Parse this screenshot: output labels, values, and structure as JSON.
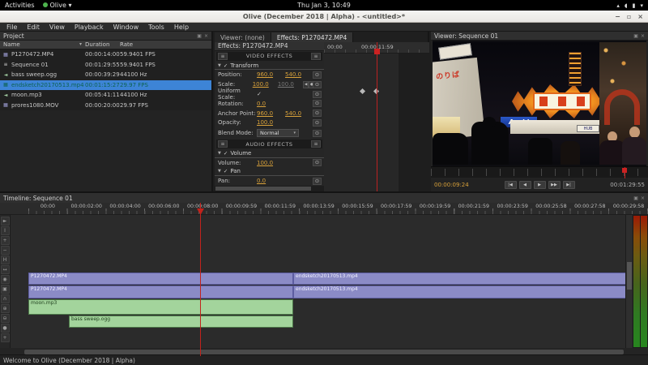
{
  "gnome_bar": {
    "activities": "Activities",
    "app_name": "Olive",
    "app_chevron": "▾",
    "clock": "Thu Jan 3, 10:49",
    "tray_icons": [
      {
        "name": "network-icon",
        "glyph": "▴"
      },
      {
        "name": "volume-icon",
        "glyph": "◖"
      },
      {
        "name": "battery-icon",
        "glyph": "▮"
      },
      {
        "name": "chevron-down-icon",
        "glyph": "▾"
      }
    ]
  },
  "window": {
    "title": "Olive (December 2018 | Alpha) - <untitled>*",
    "minimize_glyph": "−",
    "maximize_glyph": "▫",
    "close_glyph": "×"
  },
  "menu_bar": {
    "items": [
      "File",
      "Edit",
      "View",
      "Playback",
      "Window",
      "Tools",
      "Help"
    ]
  },
  "icons": {
    "panel_popout": "▣",
    "panel_close": "×",
    "menu": "≡",
    "collapse": "▼",
    "check": "✓",
    "keyframe_toggle": "⊙",
    "sort": "▾",
    "dropdown": "▾"
  },
  "project_panel": {
    "title": "Project",
    "columns": {
      "name": "Name",
      "duration": "Duration",
      "rate": "Rate"
    },
    "items": [
      {
        "name": "P1270472.MP4",
        "duration": "00:00:14:00",
        "rate": "59.9401 FPS",
        "type": "video",
        "selected": false
      },
      {
        "name": "Sequence 01",
        "duration": "00:01:29:55",
        "rate": "59.9401 FPS",
        "type": "sequence",
        "selected": false
      },
      {
        "name": "bass sweep.ogg",
        "duration": "00:00:39:29",
        "rate": "44100 Hz",
        "type": "audio",
        "selected": false
      },
      {
        "name": "endsketch20170513.mp4",
        "duration": "00:01:15:27",
        "rate": "29.97 FPS",
        "type": "video",
        "selected": true
      },
      {
        "name": "moon.mp3",
        "duration": "00:05:41:11",
        "rate": "44100 Hz",
        "type": "audio",
        "selected": false
      },
      {
        "name": "prores1080.MOV",
        "duration": "00:00:20:00",
        "rate": "29.97 FPS",
        "type": "video",
        "selected": false
      }
    ]
  },
  "effects_panel": {
    "tabs": [
      {
        "label": "Viewer: (none)",
        "active": false
      },
      {
        "label": "Effects: P1270472.MP4",
        "active": true
      }
    ],
    "title": "Effects: P1270472.MP4",
    "video_effects_header": "VIDEO EFFECTS",
    "audio_effects_header": "AUDIO EFFECTS",
    "transform": {
      "section_label": "Transform",
      "position_label": "Position:",
      "position_x": "960.0",
      "position_y": "540.0",
      "scale_label": "Scale:",
      "scale_x": "100.0",
      "scale_y": "100.0",
      "uniform_label": "Uniform Scale:",
      "uniform_checked": "✓",
      "rotation_label": "Rotation:",
      "rotation": "0.0",
      "anchor_label": "Anchor Point:",
      "anchor_x": "960.0",
      "anchor_y": "540.0",
      "opacity_label": "Opacity:",
      "opacity": "100.0",
      "blend_label": "Blend Mode:",
      "blend_value": "Normal"
    },
    "volume": {
      "section_label": "Volume",
      "row_label": "Volume:",
      "value": "100.0"
    },
    "pan": {
      "section_label": "Pan",
      "row_label": "Pan:",
      "value": "0.0"
    },
    "keyframes": {
      "start_label": "00:00",
      "playhead_label": "00:00:11:59"
    }
  },
  "viewer": {
    "title": "Viewer: Sequence 01",
    "current_time": "00:00:09:24",
    "duration": "00:01:29:55",
    "transport": [
      {
        "name": "go-to-start-button",
        "glyph": "|◀"
      },
      {
        "name": "previous-frame-button",
        "glyph": "◀"
      },
      {
        "name": "play-button",
        "glyph": "▶"
      },
      {
        "name": "next-frame-button",
        "glyph": "▶▶"
      },
      {
        "name": "go-to-end-button",
        "glyph": "▶|"
      }
    ],
    "scene": {
      "asahi_sign": "Asahi",
      "noriba_sign": "のりば",
      "hub_sign": "HUB"
    }
  },
  "timeline": {
    "title": "Timeline: Sequence 01",
    "ruler_labels": [
      "00:00",
      "00:00:02:00",
      "00:00:04:00",
      "00:00:06:00",
      "00:00:08:00",
      "00:00:09:59",
      "00:00:11:59",
      "00:00:13:59",
      "00:00:15:59",
      "00:00:17:59",
      "00:00:19:59",
      "00:00:21:59",
      "00:00:23:59",
      "00:00:25:58",
      "00:00:27:58",
      "00:00:29:58"
    ],
    "tools": [
      {
        "name": "pointer-tool",
        "glyph": "►"
      },
      {
        "name": "edit-tool",
        "glyph": "I"
      },
      {
        "name": "ripple-tool",
        "glyph": "+"
      },
      {
        "name": "razor-tool",
        "glyph": "−"
      },
      {
        "name": "slip-tool",
        "glyph": "H"
      },
      {
        "name": "slide-tool",
        "glyph": "↔"
      },
      {
        "name": "hand-tool",
        "glyph": "◉"
      },
      {
        "name": "transition-tool",
        "glyph": "▣"
      },
      {
        "name": "snapping-toggle",
        "glyph": "∩"
      },
      {
        "name": "zoom-in-tool",
        "glyph": "⊕"
      },
      {
        "name": "zoom-out-tool",
        "glyph": "⊖"
      },
      {
        "name": "record-button",
        "glyph": "●"
      },
      {
        "name": "add-button",
        "glyph": "+"
      }
    ],
    "clips": {
      "v2a": "P1270472.MP4",
      "v2b": "endsketch20170513.mp4",
      "v1a": "P1270472.MP4",
      "v1b": "endsketch20170513.mp4",
      "a1": "moon.mp3",
      "a2": "bass sweep.ogg"
    }
  },
  "status_bar": {
    "message": "Welcome to Olive (December 2018 | Alpha)"
  },
  "colors": {
    "accent_orange": "#d8a13a",
    "selection_blue": "#3d84d6",
    "playhead_red": "#c2231c",
    "video_clip": "#8b8bc6",
    "audio_clip": "#a3d49c"
  }
}
